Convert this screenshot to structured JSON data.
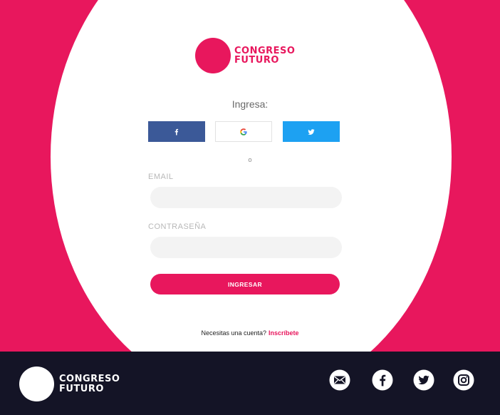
{
  "brand": {
    "name_line1": "CONGRESO",
    "name_line2": "FUTURO",
    "color": "#e8175d"
  },
  "login": {
    "heading": "Ingresa:",
    "social": [
      {
        "name": "facebook",
        "icon": "facebook-icon",
        "color": "#3b5998"
      },
      {
        "name": "google",
        "icon": "google-icon",
        "color": "#ffffff"
      },
      {
        "name": "twitter",
        "icon": "twitter-icon",
        "color": "#1da1f2"
      }
    ],
    "separator": "o",
    "email": {
      "label": "EMAIL",
      "value": "",
      "placeholder": ""
    },
    "password": {
      "label": "CONTRASEÑA",
      "value": "",
      "placeholder": ""
    },
    "submit_label": "INGRESAR",
    "signup_prompt": "Necesitas una cuenta?",
    "signup_link": "Inscríbete"
  },
  "footer": {
    "name_line1": "CONGRESO",
    "name_line2": "FUTURO",
    "background": "#141426",
    "icons": [
      "mail-icon",
      "facebook-icon",
      "twitter-icon",
      "instagram-icon"
    ]
  }
}
